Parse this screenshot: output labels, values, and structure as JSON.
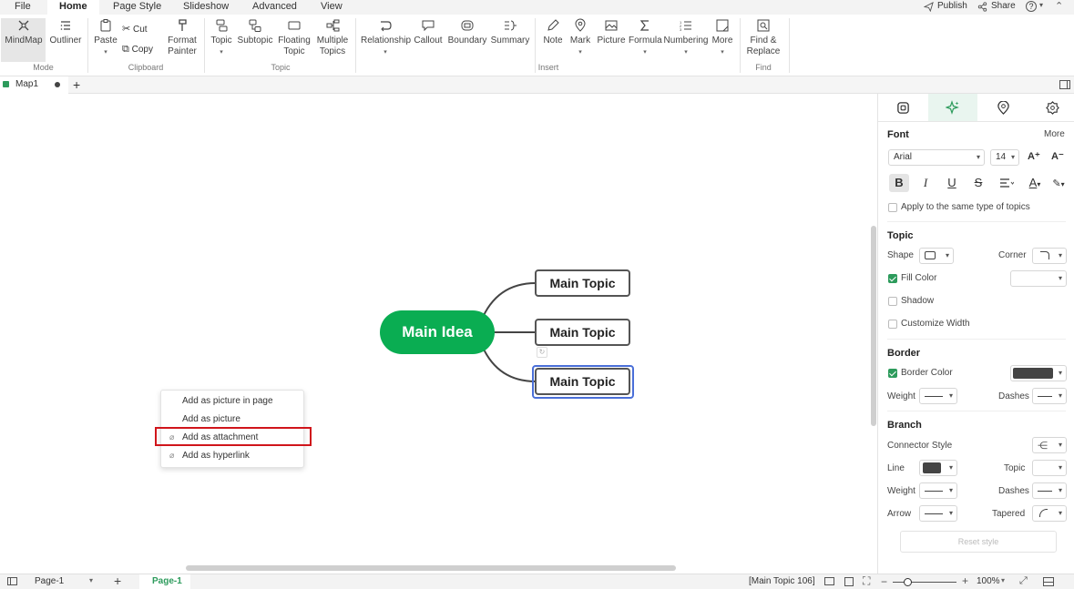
{
  "menu": {
    "tabs": [
      "File",
      "Home",
      "Page Style",
      "Slideshow",
      "Advanced",
      "View"
    ],
    "publish": "Publish",
    "share": "Share",
    "help": "?"
  },
  "ribbon": {
    "mode": {
      "mindmap": "MindMap",
      "outliner": "Outliner",
      "group": "Mode"
    },
    "clipboard": {
      "paste": "Paste",
      "cut": "Cut",
      "copy": "Copy",
      "format_painter_1": "Format",
      "format_painter_2": "Painter",
      "group": "Clipboard"
    },
    "topic": {
      "topic": "Topic",
      "subtopic": "Subtopic",
      "floating_1": "Floating",
      "floating_2": "Topic",
      "multiple_1": "Multiple",
      "multiple_2": "Topics",
      "group": "Topic"
    },
    "insert": {
      "relationship": "Relationship",
      "callout": "Callout",
      "boundary": "Boundary",
      "summary": "Summary",
      "note": "Note",
      "mark": "Mark",
      "picture": "Picture",
      "formula": "Formula",
      "numbering": "Numbering",
      "more": "More",
      "group": "Insert"
    },
    "find": {
      "find_1": "Find &",
      "find_2": "Replace",
      "group": "Find"
    }
  },
  "doc_tab": {
    "name": "Map1",
    "add": "+"
  },
  "mindmap": {
    "main_idea": "Main Idea",
    "topics": [
      "Main Topic",
      "Main Topic",
      "Main Topic"
    ],
    "colors": {
      "main": "#0aad52",
      "selected": "#4a6fd8"
    }
  },
  "context_menu": {
    "items": [
      "Add as picture in page",
      "Add as picture",
      "Add as attachment",
      "Add as hyperlink"
    ],
    "highlight_color": "#d0151b"
  },
  "panel": {
    "font": {
      "title": "Font",
      "more": "More",
      "family": "Arial",
      "size": "14",
      "apply_same": "Apply to the same type of topics"
    },
    "topic": {
      "title": "Topic",
      "shape": "Shape",
      "corner": "Corner",
      "fill_color": "Fill Color",
      "shadow": "Shadow",
      "customize_width": "Customize Width"
    },
    "border": {
      "title": "Border",
      "border_color": "Border Color",
      "weight": "Weight",
      "dashes": "Dashes",
      "color": "#444444"
    },
    "branch": {
      "title": "Branch",
      "connector_style": "Connector Style",
      "line": "Line",
      "topic": "Topic",
      "weight": "Weight",
      "dashes": "Dashes",
      "arrow": "Arrow",
      "tapered": "Tapered",
      "line_color": "#444444"
    },
    "reset": "Reset style"
  },
  "status": {
    "page_select": "Page-1",
    "add": "+",
    "active_page": "Page-1",
    "selection_info": "[Main Topic 106]",
    "zoom": "100%",
    "zoom_plus": "+"
  }
}
